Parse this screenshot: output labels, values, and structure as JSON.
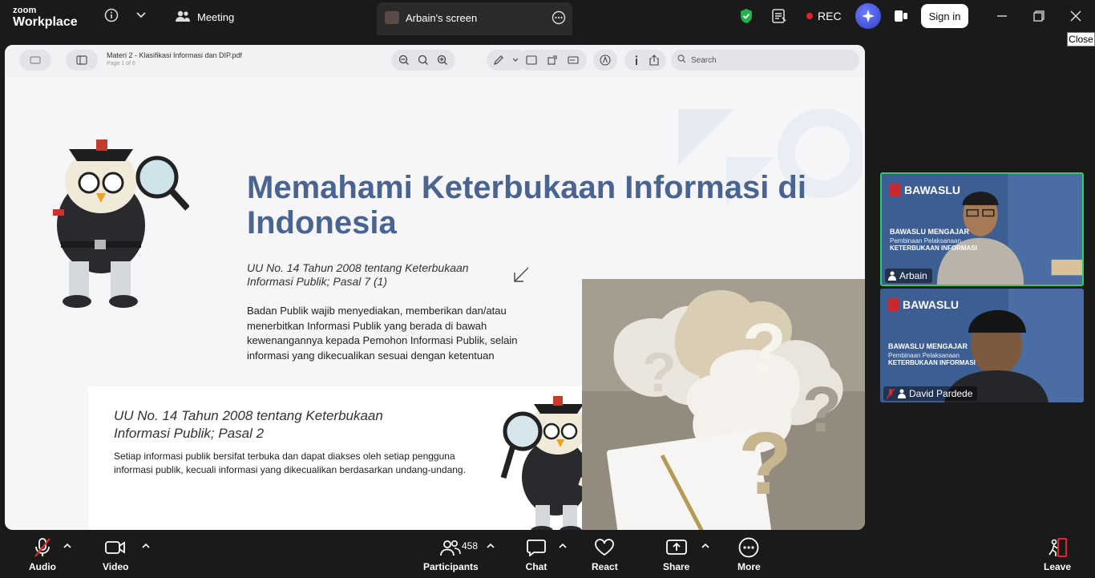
{
  "topbar": {
    "brand_line1": "zoom",
    "brand_line2": "Workplace",
    "meeting_label": "Meeting",
    "screen_tab_label": "Arbain's screen",
    "rec_label": "REC",
    "signin_label": "Sign in",
    "close_tooltip": "Close",
    "icons": [
      "info-icon",
      "chevron-down-icon",
      "people-icon",
      "more-icon",
      "shield-icon",
      "notes-icon",
      "ai-companion-icon",
      "apps-icon",
      "minimize-icon",
      "restore-icon",
      "close-icon"
    ]
  },
  "pdf_viewer": {
    "filename": "Materi 2 - Klasifikasi Informasi dan DIP.pdf",
    "page": "Page 1 of 6",
    "search_placeholder": "Search"
  },
  "slide": {
    "title": "Memahami Keterbukaan Informasi di Indonesia",
    "subtitle1": "UU No. 14 Tahun 2008 tentang Keterbukaan Informasi Publik; Pasal 7 (1)",
    "paragraph1": "Badan Publik wajib menyediakan, memberikan dan/atau menerbitkan Informasi Publik yang berada di bawah kewenangannya kepada Pemohon Informasi Publik, selain informasi yang dikecualikan sesuai dengan ketentuan",
    "subtitle2": "UU No. 14 Tahun 2008 tentang Keterbukaan Informasi Publik; Pasal 2",
    "paragraph2": "Setiap informasi publik bersifat terbuka dan dapat diakses oleh setiap pengguna informasi publik, kecuali informasi yang dikecualikan berdasarkan undang-undang."
  },
  "participants_tiles": [
    {
      "name": "Arbain",
      "org": "BAWASLU",
      "bg_line1": "BAWASLU MENGAJAR",
      "bg_line2": "Pembinaan Pelaksanaan",
      "bg_line3": "KETERBUKAAN INFORMASI",
      "active_speaker": true
    },
    {
      "name": "David Pardede",
      "org": "BAWASLU",
      "bg_line1": "BAWASLU MENGAJAR",
      "bg_line2": "Pembinaan Pelaksanaan",
      "bg_line3": "KETERBUKAAN INFORMASI",
      "active_speaker": false
    }
  ],
  "toolbar": {
    "audio_label": "Audio",
    "video_label": "Video",
    "participants_label": "Participants",
    "participants_count": "458",
    "chat_label": "Chat",
    "react_label": "React",
    "share_label": "Share",
    "more_label": "More",
    "leave_label": "Leave"
  },
  "colors": {
    "app_bg": "#1a1a1a",
    "title_blue": "#4a6492",
    "rec_red": "#e0262b",
    "active_speaker_border": "#2fcc6a",
    "leave_red": "#e0262b"
  }
}
